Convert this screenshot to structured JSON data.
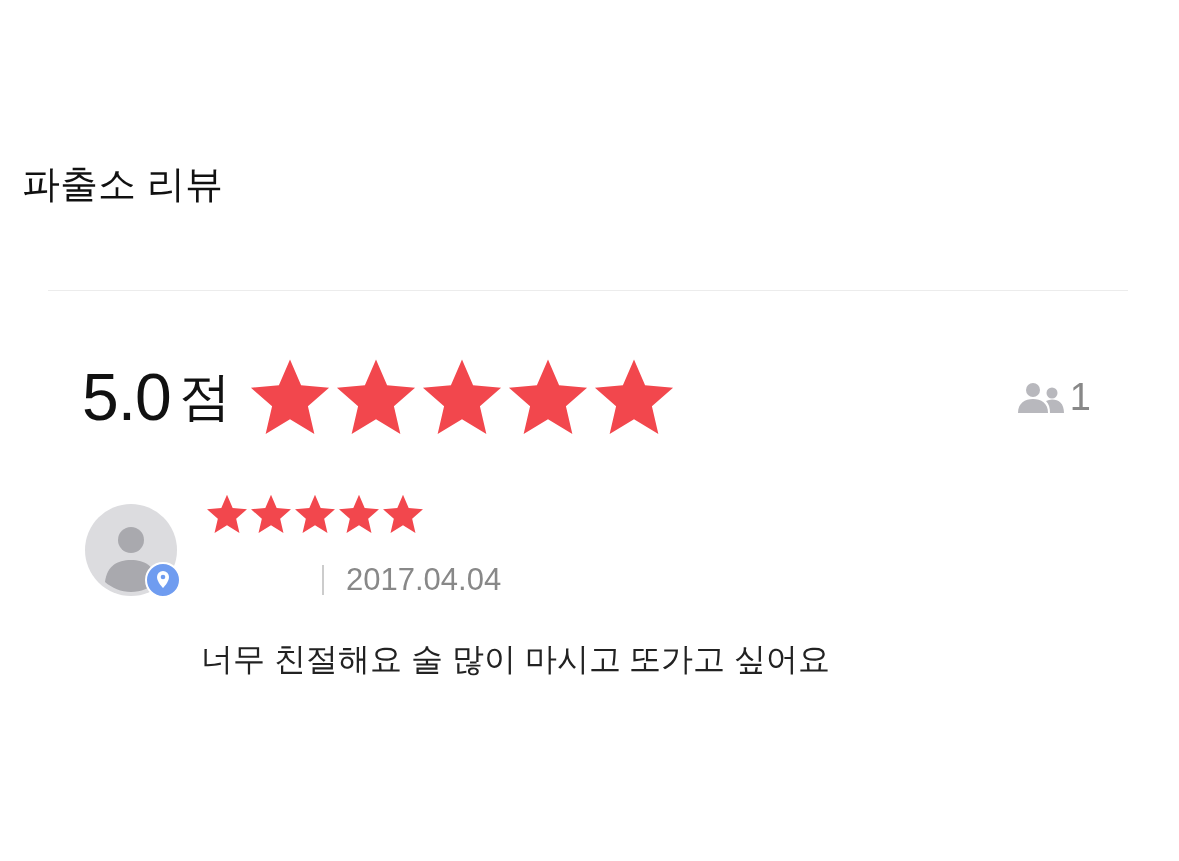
{
  "title": "파출소 리뷰",
  "summary": {
    "score": "5.0",
    "unit": "점",
    "stars": 5,
    "reviewer_count": "1"
  },
  "reviews": [
    {
      "stars": 5,
      "date": "2017.04.04",
      "text": "너무 친절해요 술 많이 마시고 또가고 싶어요"
    }
  ]
}
